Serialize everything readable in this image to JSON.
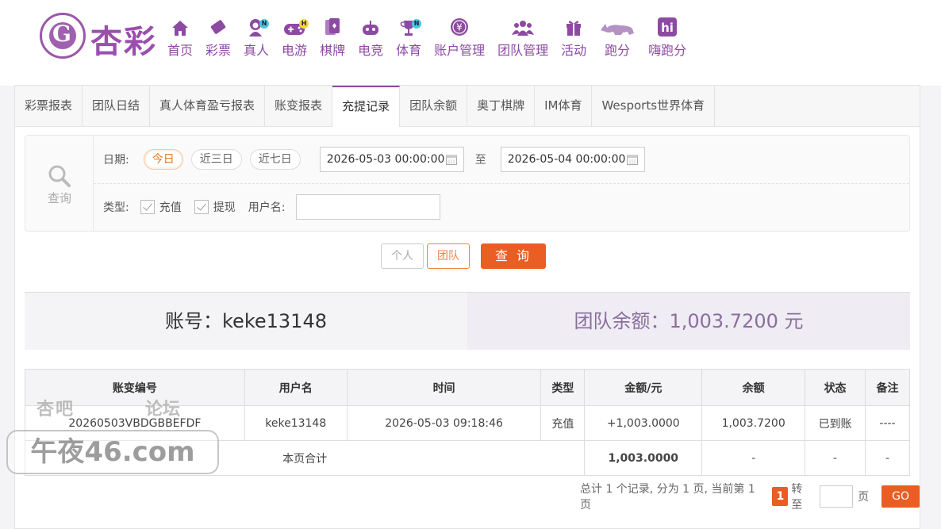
{
  "brand": {
    "logo_text": "杏彩",
    "logo_letter": "G"
  },
  "nav": [
    {
      "label": "首页",
      "icon": "home-icon"
    },
    {
      "label": "彩票",
      "icon": "lottery-ticket-icon"
    },
    {
      "label": "真人",
      "icon": "live-dealer-icon",
      "badge": "N"
    },
    {
      "label": "电游",
      "icon": "gamepad-icon",
      "badge": "H"
    },
    {
      "label": "棋牌",
      "icon": "cards-icon"
    },
    {
      "label": "电竞",
      "icon": "esports-controller-icon"
    },
    {
      "label": "体育",
      "icon": "trophy-icon",
      "badge": "N"
    },
    {
      "label": "账户管理",
      "icon": "yen-coin-icon"
    },
    {
      "label": "团队管理",
      "icon": "team-icon"
    },
    {
      "label": "活动",
      "icon": "gift-icon"
    },
    {
      "label": "跑分",
      "icon": "rhino-icon"
    },
    {
      "label": "嗨跑分",
      "icon": "hi-app-icon"
    }
  ],
  "tabs": [
    "彩票报表",
    "团队日结",
    "真人体育盈亏报表",
    "账变报表",
    "充提记录",
    "团队余额",
    "奥丁棋牌",
    "IM体育",
    "Wesports世界体育"
  ],
  "active_tab": "充提记录",
  "filter": {
    "search_label": "查询",
    "date_label": "日期:",
    "quick_ranges": [
      "今日",
      "近三日",
      "近七日"
    ],
    "active_range": "今日",
    "start_date": "2026-05-03 00:00:00",
    "to_label": "至",
    "end_date": "2026-05-04 00:00:00",
    "type_label": "类型:",
    "type_options": [
      {
        "label": "充值",
        "checked": true
      },
      {
        "label": "提现",
        "checked": true
      }
    ],
    "username_label": "用户名:",
    "username_value": ""
  },
  "buttons": {
    "personal": "个人",
    "team": "团队",
    "query": "查 询"
  },
  "summary": {
    "account": "账号：keke13148",
    "team_balance": "团队余额：1,003.7200 元"
  },
  "table": {
    "headers": [
      "账变编号",
      "用户名",
      "时间",
      "类型",
      "金额/元",
      "余额",
      "状态",
      "备注"
    ],
    "rows": [
      [
        "20260503VBDGBBEFDF",
        "keke13148",
        "2026-05-03 09:18:46",
        "充值",
        "+1,003.0000",
        "1,003.7200",
        "已到账",
        "----"
      ]
    ],
    "footer": {
      "label": "本页合计",
      "amount": "1,003.0000",
      "balance": "-",
      "status": "-",
      "note": "-"
    }
  },
  "pager": {
    "summary": "总计 1 个记录, 分为 1 页, 当前第 1 页",
    "current": "1",
    "goto_label": "转至",
    "page_unit": "页",
    "go_label": "GO"
  },
  "watermark": {
    "top_left": "杏吧",
    "top_right": "论坛",
    "main": "午夜46.com"
  },
  "colors": {
    "brand": "#8d4aa3",
    "accent": "#ea5d23",
    "success": "#3a9a3a"
  }
}
